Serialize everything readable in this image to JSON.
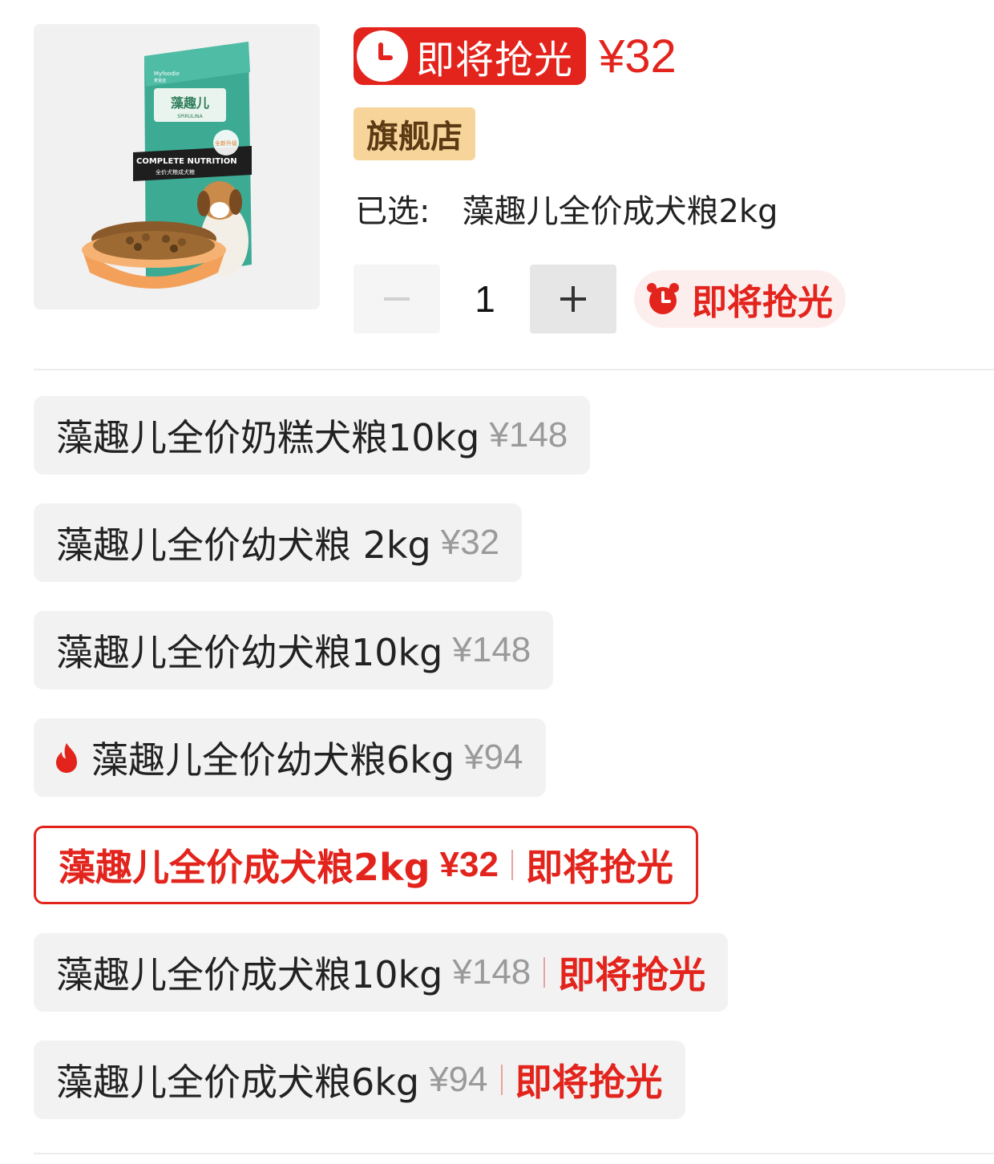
{
  "header": {
    "flash_label": "即将抢光",
    "price": "¥32",
    "store_badge": "旗舰店",
    "selected_label": "已选:",
    "selected_value": "藻趣儿全价成犬粮2kg"
  },
  "quantity": {
    "minus": "−",
    "value": "1",
    "plus": "+",
    "flash_label": "即将抢光"
  },
  "product_image": {
    "brand": "Myfoodie",
    "brand_cn": "麦富迪",
    "name": "藻趣儿",
    "sub": "SPIRULINA",
    "banner": "COMPLETE NUTRITION",
    "banner_cn": "全价犬粮成犬粮",
    "upgrade": "全新升级"
  },
  "variants": [
    {
      "name": "藻趣儿全价奶糕犬粮10kg",
      "price": "¥148",
      "flash": ""
    },
    {
      "name": "藻趣儿全价幼犬粮 2kg",
      "price": "¥32",
      "flash": ""
    },
    {
      "name": "藻趣儿全价幼犬粮10kg",
      "price": "¥148",
      "flash": ""
    },
    {
      "name": "藻趣儿全价幼犬粮6kg",
      "price": "¥94",
      "flash": "",
      "hot": true
    },
    {
      "name": "藻趣儿全价成犬粮2kg",
      "price": "¥32",
      "flash": "即将抢光",
      "selected": true
    },
    {
      "name": "藻趣儿全价成犬粮10kg",
      "price": "¥148",
      "flash": "即将抢光"
    },
    {
      "name": "藻趣儿全价成犬粮6kg",
      "price": "¥94",
      "flash": "即将抢光"
    }
  ],
  "colors": {
    "accent": "#e3241d",
    "store_badge_bg": "#f6d49a",
    "chip_bg": "#f2f2f2"
  }
}
